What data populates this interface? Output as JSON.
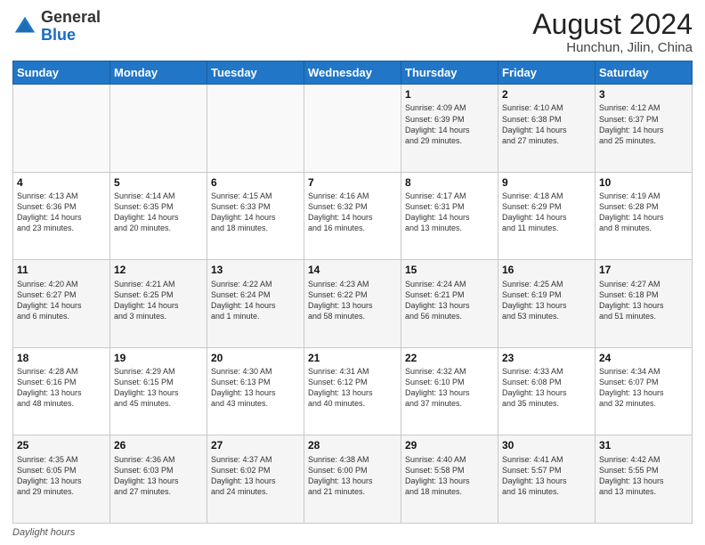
{
  "logo": {
    "general": "General",
    "blue": "Blue"
  },
  "header": {
    "month_year": "August 2024",
    "location": "Hunchun, Jilin, China"
  },
  "days_of_week": [
    "Sunday",
    "Monday",
    "Tuesday",
    "Wednesday",
    "Thursday",
    "Friday",
    "Saturday"
  ],
  "weeks": [
    [
      {
        "day": "",
        "info": ""
      },
      {
        "day": "",
        "info": ""
      },
      {
        "day": "",
        "info": ""
      },
      {
        "day": "",
        "info": ""
      },
      {
        "day": "1",
        "info": "Sunrise: 4:09 AM\nSunset: 6:39 PM\nDaylight: 14 hours\nand 29 minutes."
      },
      {
        "day": "2",
        "info": "Sunrise: 4:10 AM\nSunset: 6:38 PM\nDaylight: 14 hours\nand 27 minutes."
      },
      {
        "day": "3",
        "info": "Sunrise: 4:12 AM\nSunset: 6:37 PM\nDaylight: 14 hours\nand 25 minutes."
      }
    ],
    [
      {
        "day": "4",
        "info": "Sunrise: 4:13 AM\nSunset: 6:36 PM\nDaylight: 14 hours\nand 23 minutes."
      },
      {
        "day": "5",
        "info": "Sunrise: 4:14 AM\nSunset: 6:35 PM\nDaylight: 14 hours\nand 20 minutes."
      },
      {
        "day": "6",
        "info": "Sunrise: 4:15 AM\nSunset: 6:33 PM\nDaylight: 14 hours\nand 18 minutes."
      },
      {
        "day": "7",
        "info": "Sunrise: 4:16 AM\nSunset: 6:32 PM\nDaylight: 14 hours\nand 16 minutes."
      },
      {
        "day": "8",
        "info": "Sunrise: 4:17 AM\nSunset: 6:31 PM\nDaylight: 14 hours\nand 13 minutes."
      },
      {
        "day": "9",
        "info": "Sunrise: 4:18 AM\nSunset: 6:29 PM\nDaylight: 14 hours\nand 11 minutes."
      },
      {
        "day": "10",
        "info": "Sunrise: 4:19 AM\nSunset: 6:28 PM\nDaylight: 14 hours\nand 8 minutes."
      }
    ],
    [
      {
        "day": "11",
        "info": "Sunrise: 4:20 AM\nSunset: 6:27 PM\nDaylight: 14 hours\nand 6 minutes."
      },
      {
        "day": "12",
        "info": "Sunrise: 4:21 AM\nSunset: 6:25 PM\nDaylight: 14 hours\nand 3 minutes."
      },
      {
        "day": "13",
        "info": "Sunrise: 4:22 AM\nSunset: 6:24 PM\nDaylight: 14 hours\nand 1 minute."
      },
      {
        "day": "14",
        "info": "Sunrise: 4:23 AM\nSunset: 6:22 PM\nDaylight: 13 hours\nand 58 minutes."
      },
      {
        "day": "15",
        "info": "Sunrise: 4:24 AM\nSunset: 6:21 PM\nDaylight: 13 hours\nand 56 minutes."
      },
      {
        "day": "16",
        "info": "Sunrise: 4:25 AM\nSunset: 6:19 PM\nDaylight: 13 hours\nand 53 minutes."
      },
      {
        "day": "17",
        "info": "Sunrise: 4:27 AM\nSunset: 6:18 PM\nDaylight: 13 hours\nand 51 minutes."
      }
    ],
    [
      {
        "day": "18",
        "info": "Sunrise: 4:28 AM\nSunset: 6:16 PM\nDaylight: 13 hours\nand 48 minutes."
      },
      {
        "day": "19",
        "info": "Sunrise: 4:29 AM\nSunset: 6:15 PM\nDaylight: 13 hours\nand 45 minutes."
      },
      {
        "day": "20",
        "info": "Sunrise: 4:30 AM\nSunset: 6:13 PM\nDaylight: 13 hours\nand 43 minutes."
      },
      {
        "day": "21",
        "info": "Sunrise: 4:31 AM\nSunset: 6:12 PM\nDaylight: 13 hours\nand 40 minutes."
      },
      {
        "day": "22",
        "info": "Sunrise: 4:32 AM\nSunset: 6:10 PM\nDaylight: 13 hours\nand 37 minutes."
      },
      {
        "day": "23",
        "info": "Sunrise: 4:33 AM\nSunset: 6:08 PM\nDaylight: 13 hours\nand 35 minutes."
      },
      {
        "day": "24",
        "info": "Sunrise: 4:34 AM\nSunset: 6:07 PM\nDaylight: 13 hours\nand 32 minutes."
      }
    ],
    [
      {
        "day": "25",
        "info": "Sunrise: 4:35 AM\nSunset: 6:05 PM\nDaylight: 13 hours\nand 29 minutes."
      },
      {
        "day": "26",
        "info": "Sunrise: 4:36 AM\nSunset: 6:03 PM\nDaylight: 13 hours\nand 27 minutes."
      },
      {
        "day": "27",
        "info": "Sunrise: 4:37 AM\nSunset: 6:02 PM\nDaylight: 13 hours\nand 24 minutes."
      },
      {
        "day": "28",
        "info": "Sunrise: 4:38 AM\nSunset: 6:00 PM\nDaylight: 13 hours\nand 21 minutes."
      },
      {
        "day": "29",
        "info": "Sunrise: 4:40 AM\nSunset: 5:58 PM\nDaylight: 13 hours\nand 18 minutes."
      },
      {
        "day": "30",
        "info": "Sunrise: 4:41 AM\nSunset: 5:57 PM\nDaylight: 13 hours\nand 16 minutes."
      },
      {
        "day": "31",
        "info": "Sunrise: 4:42 AM\nSunset: 5:55 PM\nDaylight: 13 hours\nand 13 minutes."
      }
    ]
  ],
  "footer": {
    "label": "Daylight hours"
  }
}
